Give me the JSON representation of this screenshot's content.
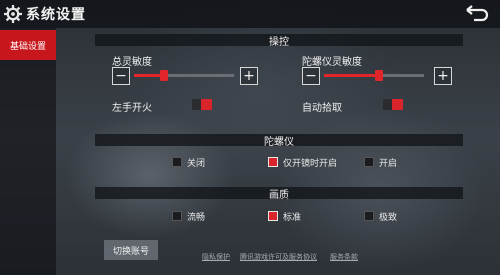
{
  "header": {
    "title": "系统设置",
    "back_icon": "back-arrow-icon",
    "gear_icon": "gear-icon"
  },
  "sidebar": {
    "items": [
      {
        "label": "基础设置",
        "active": true
      }
    ]
  },
  "sections": {
    "controls": {
      "title": "操控",
      "sensitivity": {
        "label": "总灵敏度",
        "minus": "−",
        "plus": "+",
        "value": 0.3
      },
      "gyro_sensitivity": {
        "label": "陀螺仪灵敏度",
        "minus": "−",
        "plus": "+",
        "value": 0.55
      },
      "left_fire": {
        "label": "左手开火",
        "on": true
      },
      "auto_pickup": {
        "label": "自动拾取",
        "on": true
      }
    },
    "gyroscope": {
      "title": "陀螺仪",
      "options": [
        {
          "label": "关闭",
          "selected": false
        },
        {
          "label": "仅开镜时开启",
          "selected": true
        },
        {
          "label": "开启",
          "selected": false
        }
      ]
    },
    "quality": {
      "title": "画质",
      "options": [
        {
          "label": "流畅",
          "selected": false
        },
        {
          "label": "标准",
          "selected": true
        },
        {
          "label": "极致",
          "selected": false
        }
      ]
    }
  },
  "footer": {
    "switch_account": "切换账号",
    "links": [
      "隐私保护",
      "腾讯游戏许可及服务协议",
      "服务条款"
    ]
  },
  "colors": {
    "accent": "#d8242a"
  }
}
